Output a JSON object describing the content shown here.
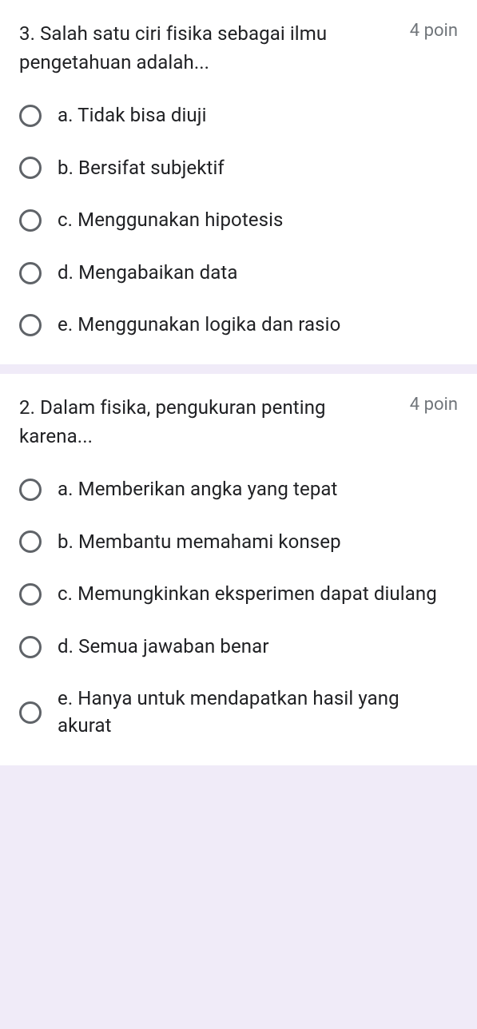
{
  "questions": [
    {
      "text": "3. Salah satu ciri fisika sebagai ilmu pengetahuan adalah...",
      "points": "4 poin",
      "options": [
        "a. Tidak bisa diuji",
        "b. Bersifat subjektif",
        "c. Menggunakan hipotesis",
        "d. Mengabaikan data",
        "e. Menggunakan logika dan rasio"
      ]
    },
    {
      "text": "2. Dalam fisika, pengukuran penting karena...",
      "points": "4 poin",
      "options": [
        "a. Memberikan angka yang tepat",
        "b. Membantu memahami konsep",
        "c. Memungkinkan eksperimen dapat diulang",
        "d. Semua jawaban benar",
        "e. Hanya untuk mendapatkan hasil yang akurat"
      ]
    }
  ]
}
